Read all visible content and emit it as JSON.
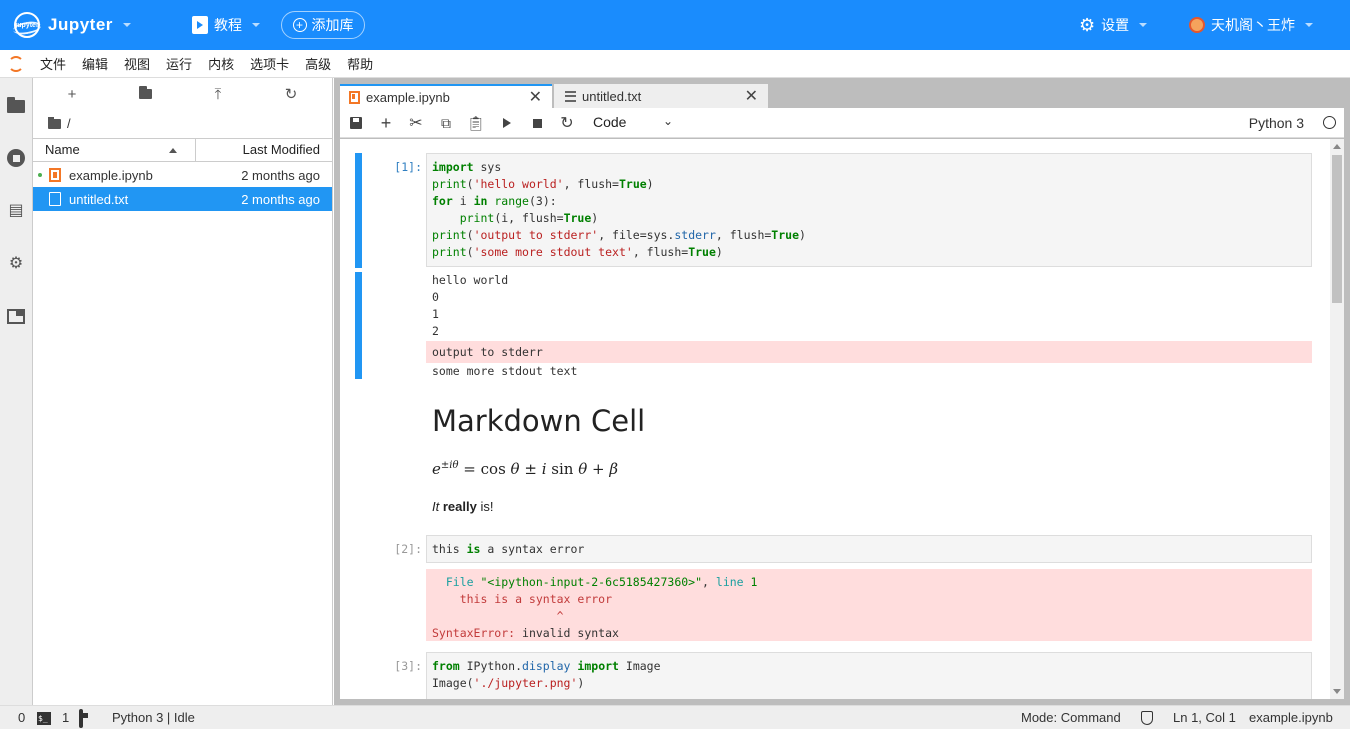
{
  "topbar": {
    "brand": "Jupyter",
    "tutorial": "教程",
    "add_library": "添加库",
    "settings": "设置",
    "user": "天机阁丶王炸"
  },
  "menu": [
    "文件",
    "编辑",
    "视图",
    "运行",
    "内核",
    "选项卡",
    "高级",
    "帮助"
  ],
  "filebrowser": {
    "path": "/",
    "col_name": "Name",
    "col_modified": "Last Modified",
    "files": [
      {
        "name": "example.ipynb",
        "modified": "2 months ago"
      },
      {
        "name": "untitled.txt",
        "modified": "2 months ago"
      }
    ]
  },
  "tabs": [
    {
      "label": "example.ipynb"
    },
    {
      "label": "untitled.txt"
    }
  ],
  "notebook_toolbar": {
    "cell_type": "Code",
    "kernel_name": "Python 3"
  },
  "cells": {
    "c1_prompt": "[1]:",
    "c1_lines": [
      "import sys",
      "print('hello world', flush=True)",
      "for i in range(3):",
      "    print(i, flush=True)",
      "print('output to stderr', file=sys.stderr, flush=True)",
      "print('some more stdout text', flush=True)"
    ],
    "c1_out": [
      "hello world",
      "0",
      "1",
      "2"
    ],
    "c1_err": "output to stderr",
    "c1_out2": "some more stdout text",
    "md_heading": "Markdown Cell",
    "md_emph": "It",
    "md_bold": "really",
    "md_rest": "is!",
    "c2_prompt": "[2]:",
    "c2_code": "this is a syntax error",
    "c2_err_lines": [
      "  File \"<ipython-input-2-6c5185427360>\", line 1",
      "    this is a syntax error",
      "                  ^",
      "SyntaxError: invalid syntax"
    ],
    "c3_prompt": "[3]:",
    "c3_lines": [
      "from IPython.display import Image",
      "Image('./jupyter.png')"
    ]
  },
  "statusbar": {
    "terminals": "0",
    "kernels": "1",
    "kernel_status": "Python 3 | Idle",
    "mode": "Mode: Command",
    "position": "Ln 1, Col 1",
    "file": "example.ipynb"
  }
}
